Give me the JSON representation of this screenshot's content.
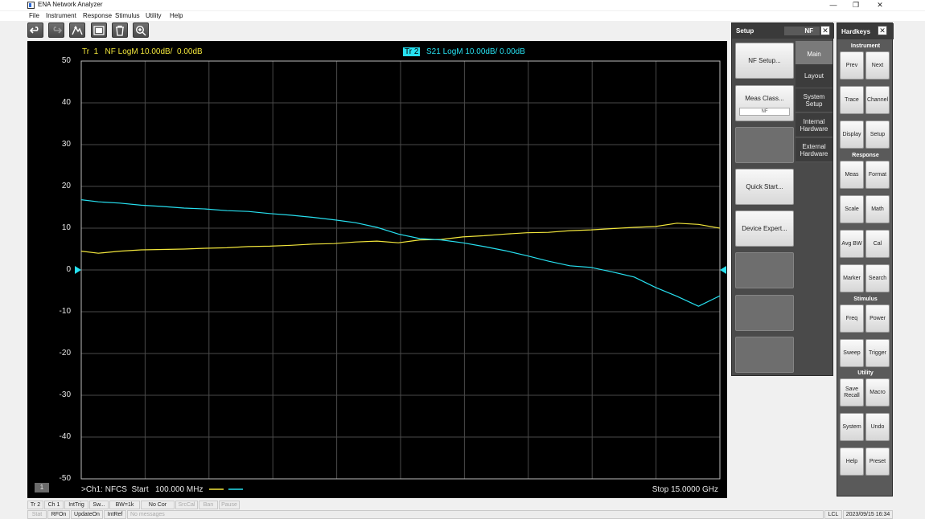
{
  "window": {
    "title": "ENA Network Analyzer",
    "minimize": "—",
    "restore": "❐",
    "close": "✕"
  },
  "menu": [
    "File",
    "Instrument",
    "Response",
    "Stimulus",
    "Utility",
    "Help"
  ],
  "toolbar": [
    "undo-icon",
    "redo-icon",
    "marker-icon",
    "screenshot-icon",
    "trash-icon",
    "zoom-icon"
  ],
  "trace": {
    "tr1": "Tr  1   NF LogM 10.00dB/  0.00dB",
    "tr2_tag": "Tr  2",
    "tr2": "S21 LogM 10.00dB/  0.00dB",
    "yticks": [
      "50",
      "40",
      "30",
      "20",
      "10",
      "0",
      "-10",
      "-20",
      "-30",
      "-40",
      "-50"
    ],
    "channel": ">Ch1: NFCS  Start   100.000 MHz",
    "stop": "Stop  15.0000 GHz",
    "channel_num": "1",
    "colors": {
      "tr1": "#f2e63c",
      "tr2": "#27e0f0",
      "grid": "#4a4a4a",
      "frame": "#bdbdbd"
    }
  },
  "chart_data": {
    "type": "line",
    "xlabel": "",
    "ylabel": "",
    "x_start_ghz": 0.1,
    "x_stop_ghz": 15.0,
    "ylim": [
      -50,
      50
    ],
    "grid": true,
    "series": [
      {
        "name": "NF",
        "color": "#f2e63c",
        "x": [
          0.1,
          0.5,
          1,
          1.5,
          2,
          2.5,
          3,
          3.5,
          4,
          4.5,
          5,
          5.5,
          6,
          6.5,
          7,
          7.5,
          8,
          8.5,
          9,
          9.5,
          10,
          10.5,
          11,
          11.5,
          12,
          12.5,
          13,
          13.5,
          14,
          14.5,
          15
        ],
        "y": [
          4.5,
          4.0,
          4.5,
          4.8,
          4.9,
          5.0,
          5.2,
          5.3,
          5.6,
          5.7,
          5.9,
          6.2,
          6.3,
          6.7,
          6.9,
          6.5,
          7.2,
          7.3,
          7.9,
          8.2,
          8.6,
          8.9,
          9.0,
          9.4,
          9.6,
          9.9,
          10.2,
          10.4,
          11.2,
          10.9,
          10.0
        ]
      },
      {
        "name": "S21",
        "color": "#27e0f0",
        "x": [
          0.1,
          0.5,
          1,
          1.5,
          2,
          2.5,
          3,
          3.5,
          4,
          4.5,
          5,
          5.5,
          6,
          6.5,
          7,
          7.5,
          8,
          8.5,
          9,
          9.5,
          10,
          10.5,
          11,
          11.5,
          12,
          12.5,
          13,
          13.5,
          14,
          14.5,
          15
        ],
        "y": [
          16.8,
          16.3,
          16.0,
          15.5,
          15.2,
          14.8,
          14.6,
          14.2,
          14.0,
          13.5,
          13.1,
          12.6,
          12.0,
          11.3,
          10.2,
          8.6,
          7.5,
          7.2,
          6.5,
          5.6,
          4.6,
          3.4,
          2.1,
          1.0,
          0.6,
          -0.5,
          -1.7,
          -4.2,
          -6.3,
          -8.7,
          -6.2
        ]
      }
    ]
  },
  "setup": {
    "title": "Setup",
    "mode": "NF",
    "close": "✕",
    "softkeys": [
      {
        "label": "NF Setup...",
        "sub": ""
      },
      {
        "label": "Meas Class...",
        "sub": "NF"
      },
      {
        "label": "",
        "sub": ""
      },
      {
        "label": "Quick Start...",
        "sub": ""
      },
      {
        "label": "Device Expert...",
        "sub": ""
      },
      {
        "label": "",
        "sub": ""
      },
      {
        "label": "",
        "sub": ""
      },
      {
        "label": "",
        "sub": ""
      }
    ],
    "tabs": [
      "Main",
      "Layout",
      "System Setup",
      "Internal Hardware",
      "External Hardware"
    ],
    "active_tab": "Main"
  },
  "hardkeys": {
    "title": "Hardkeys",
    "close": "✕",
    "sections": [
      {
        "name": "Instrument",
        "keys": [
          "Prev",
          "Next",
          "Trace",
          "Channel",
          "Display",
          "Setup"
        ]
      },
      {
        "name": "Response",
        "keys": [
          "Meas",
          "Format",
          "Scale",
          "Math",
          "Avg BW",
          "Cal",
          "Marker",
          "Search"
        ]
      },
      {
        "name": "Stimulus",
        "keys": [
          "Freq",
          "Power",
          "Sweep",
          "Trigger"
        ]
      },
      {
        "name": "Utility",
        "keys": [
          "Save Recall",
          "Macro",
          "System",
          "Undo",
          "Help",
          "Preset"
        ]
      }
    ]
  },
  "status": {
    "row1": [
      "Tr 2",
      "Ch 1",
      "IntTrig",
      "Sw...",
      "BW=1k",
      "No Cor",
      "SrcCal",
      "Ban",
      "Pause"
    ],
    "row2": [
      "Stat",
      "RFOn",
      "UpdateOn",
      "IntRef",
      "No messages"
    ],
    "right": [
      "LCL",
      "2023/09/15 16:34"
    ]
  }
}
